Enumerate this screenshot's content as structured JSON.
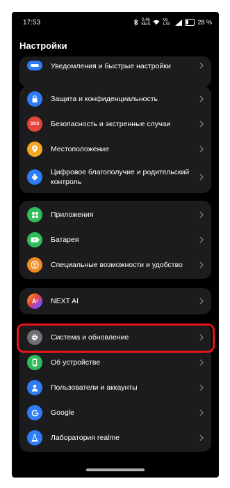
{
  "status_bar": {
    "time": "17:53",
    "net_speed_top": "0,46",
    "net_speed_bottom": "КБ/S",
    "network_label": "Vo LTE",
    "battery": "28 %"
  },
  "page_title": "Настройки",
  "card1": {
    "item_notifications": "Уведомления и быстрые настройки"
  },
  "card2": {
    "item_privacy": "Защита и конфиденциальность",
    "item_sos": "Безопасность и экстренные случаи",
    "sos_icon_text": "SOS",
    "item_location": "Местоположение",
    "item_wellbeing": "Цифровое благополучие и родительский контроль"
  },
  "card3": {
    "item_apps": "Приложения",
    "item_battery": "Батарея",
    "item_accessibility": "Специальные возможности и удобство"
  },
  "card4": {
    "item_next_ai": "NEXT AI"
  },
  "card5": {
    "item_system": "Система и обновление",
    "item_about": "Об устройстве",
    "item_users": "Пользователи и аккаунты",
    "item_google": "Google",
    "item_lab": "Лаборатория realme"
  },
  "colors": {
    "background": "#000000",
    "card": "#1c1c1e",
    "highlight": "#e8141c",
    "icon_blue": "#2f7cf6",
    "icon_red": "#e5453b",
    "icon_orange": "#f5a623",
    "icon_green": "#2ebd59",
    "icon_gray": "#6e6e73"
  },
  "icons": {
    "notifications": "notification-icon",
    "privacy": "lock-shield-icon",
    "location": "location-pin-icon",
    "wellbeing": "heart-person-icon",
    "apps": "apps-grid-icon",
    "battery": "battery-icon",
    "accessibility": "accessibility-icon",
    "next_ai": "ai-icon",
    "system": "gear-icon",
    "about": "phone-icon",
    "users": "user-icon",
    "google": "google-icon",
    "lab": "flask-icon"
  }
}
